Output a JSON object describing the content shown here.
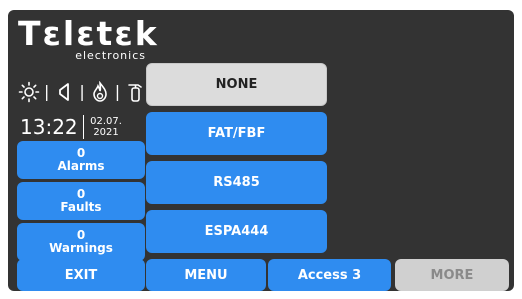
{
  "logo": {
    "word": "Tεlεtεk",
    "sub": "electronics"
  },
  "status_icons": [
    "sun-icon",
    "speaker-icon",
    "flame-icon",
    "extinguisher-icon"
  ],
  "clock": {
    "time": "13:22",
    "date_line1": "02.07.",
    "date_line2": "2021"
  },
  "side_counters": [
    {
      "count": "0",
      "label": "Alarms"
    },
    {
      "count": "0",
      "label": "Faults"
    },
    {
      "count": "0",
      "label": "Warnings"
    }
  ],
  "options": [
    {
      "label": "NONE",
      "selected": true
    },
    {
      "label": "FAT/FBF",
      "selected": false
    },
    {
      "label": "RS485",
      "selected": false
    },
    {
      "label": "ESPA444",
      "selected": false
    }
  ],
  "bottom_bar": {
    "exit": "EXIT",
    "menu": "MENU",
    "access": "Access 3",
    "more": "MORE"
  },
  "colors": {
    "panel_bg": "#333333",
    "button_blue": "#2f8cf0",
    "selected_gray": "#dcdcdc",
    "disabled_gray": "#d0d0d0"
  }
}
